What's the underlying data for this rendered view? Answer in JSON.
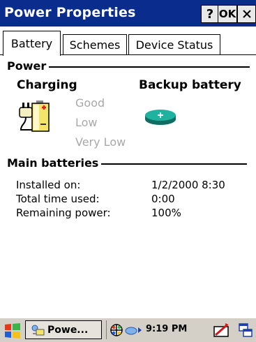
{
  "window": {
    "title": "Power Properties",
    "help_label": "?",
    "ok_label": "OK"
  },
  "tabs": [
    {
      "label": "Battery",
      "active": true
    },
    {
      "label": "Schemes",
      "active": false
    },
    {
      "label": "Device Status",
      "active": false
    }
  ],
  "power_section": {
    "title": "Power",
    "main_label": "Charging",
    "backup_label": "Backup battery",
    "levels": [
      "Good",
      "Low",
      "Very Low"
    ]
  },
  "main_batteries": {
    "title": "Main batteries",
    "rows": [
      {
        "label": "Installed on:",
        "value": "1/2/2000 8:30"
      },
      {
        "label": "Total time used:",
        "value": "0:00"
      },
      {
        "label": "Remaining power:",
        "value": "100%"
      }
    ]
  },
  "taskbar": {
    "task_label": "Powe...",
    "clock": "9:19 PM"
  },
  "colors": {
    "titlebar": "#0a2c8c",
    "taskbar": "#d4d0c8",
    "disabled_text": "#a8a8a8",
    "backup_battery": "#1a9c8c"
  }
}
